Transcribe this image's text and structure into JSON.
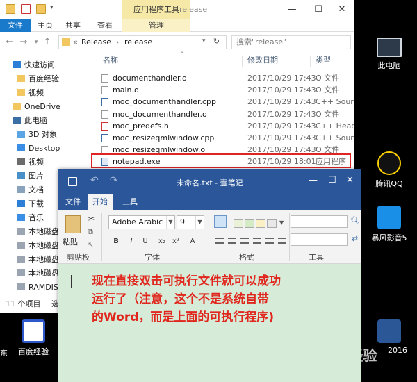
{
  "explorer": {
    "app_tools_tab": "应用程序工具",
    "window_title": "release",
    "ribbon_tabs": [
      "文件",
      "主页",
      "共享",
      "查看",
      "管理"
    ],
    "path_prefix": "«",
    "breadcrumb": [
      "Release",
      "release"
    ],
    "search_placeholder": "搜索\"release\"",
    "columns": {
      "name": "名称",
      "date": "修改日期",
      "type": "类型"
    },
    "sidebar": [
      {
        "label": "快速访问",
        "icon": "star-icon"
      },
      {
        "label": "百度经验",
        "icon": "folder-icon"
      },
      {
        "label": "视频",
        "icon": "folder-icon"
      },
      {
        "label": "OneDrive",
        "icon": "cloud-icon"
      },
      {
        "label": "此电脑",
        "icon": "computer-icon"
      },
      {
        "label": "3D 对象",
        "icon": "cube-icon"
      },
      {
        "label": "Desktop",
        "icon": "desktop-icon"
      },
      {
        "label": "视频",
        "icon": "video-icon"
      },
      {
        "label": "图片",
        "icon": "image-icon"
      },
      {
        "label": "文档",
        "icon": "document-icon"
      },
      {
        "label": "下载",
        "icon": "download-icon"
      },
      {
        "label": "音乐",
        "icon": "music-icon"
      },
      {
        "label": "本地磁盘",
        "icon": "drive-icon"
      },
      {
        "label": "本地磁盘",
        "icon": "drive-icon"
      },
      {
        "label": "本地磁盘",
        "icon": "drive-icon"
      },
      {
        "label": "本地磁盘",
        "icon": "drive-icon"
      },
      {
        "label": "RAMDISK",
        "icon": "drive-icon"
      }
    ],
    "files": [
      {
        "name": "documenthandler.o",
        "date": "2017/10/29 17:43",
        "type": "O 文件",
        "kind": "o"
      },
      {
        "name": "main.o",
        "date": "2017/10/29 17:43",
        "type": "O 文件",
        "kind": "o"
      },
      {
        "name": "moc_documenthandler.cpp",
        "date": "2017/10/29 17:43",
        "type": "C++ Source",
        "kind": "cpp"
      },
      {
        "name": "moc_documenthandler.o",
        "date": "2017/10/29 17:43",
        "type": "O 文件",
        "kind": "o"
      },
      {
        "name": "moc_predefs.h",
        "date": "2017/10/29 17:43",
        "type": "C++ Header",
        "kind": "h"
      },
      {
        "name": "moc_resizeqmlwindow.cpp",
        "date": "2017/10/29 17:43",
        "type": "C++ Source",
        "kind": "cpp"
      },
      {
        "name": "moc_resizeqmlwindow.o",
        "date": "2017/10/29 17:43",
        "type": "O 文件",
        "kind": "o"
      },
      {
        "name": "notepad.exe",
        "date": "2017/10/29 18:01",
        "type": "应用程序",
        "kind": "exe"
      }
    ],
    "status_count": "11 个项目",
    "status_selected": "选中"
  },
  "desktop": {
    "icons": [
      {
        "label": "此电脑",
        "icon": "computer-icon"
      },
      {
        "label": "腾讯QQ",
        "icon": "qq-icon"
      },
      {
        "label": "暴风影音5",
        "icon": "baofeng-icon"
      },
      {
        "label": "百度经验",
        "icon": "baidu-paw-icon"
      },
      {
        "label": "2016",
        "icon": "word-icon"
      }
    ],
    "partial_left_label": "东",
    "watermark": "Bai 经验"
  },
  "notepad": {
    "title": "未命名.txt - 壹笔记",
    "tabs": [
      "文件",
      "开始",
      "工具"
    ],
    "active_tab": "开始",
    "paste_label": "粘贴",
    "groups": {
      "clipboard": "剪贴板",
      "font": "字体",
      "format": "格式",
      "tools": "工具"
    },
    "font_name": "Adobe Arabic",
    "font_size": "9",
    "format_buttons": [
      "B",
      "I",
      "U",
      "x₂",
      "x²",
      "A"
    ],
    "annotation_lines": [
      "现在直接双击可执行文件就可以成功",
      "运行了（注意，这个不是系统自带",
      "的Word，而是上面的可执行程序)"
    ]
  },
  "colors": {
    "accent_blue": "#2b579a",
    "file_tab_blue": "#1979ca",
    "highlight_red": "#e02424",
    "editor_bg": "#d6ecd8"
  }
}
